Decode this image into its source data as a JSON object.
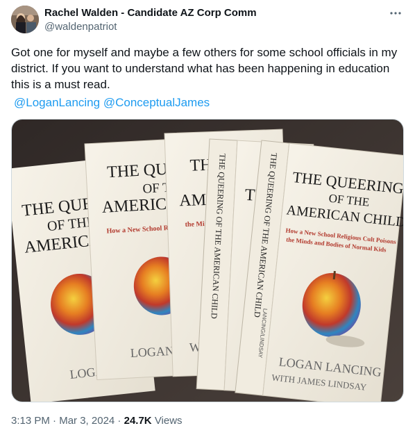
{
  "author": {
    "display_name": "Rachel Walden - Candidate AZ Corp Comm",
    "handle": "@waldenpatriot"
  },
  "more_icon": "more-horizontal-icon",
  "text": "Got one for myself and maybe a few others for some school officials in my district. If you want to understand what has been happening in education this is a must read.",
  "mentions": [
    "@LoganLancing",
    "@ConceptualJames"
  ],
  "book": {
    "title_line1": "THE QUEERING",
    "title_line2": "OF THE",
    "title_line3": "AMERICAN CHILD",
    "subtitle_line1": "How a New School Religious Cult Poisons",
    "subtitle_line2": "the Minds and Bodies of Normal Kids",
    "author_line1": "LOGAN LANCING",
    "author_line2": "WITH JAMES LINDSAY",
    "spine_title": "THE QUEERING OF THE AMERICAN CHILD",
    "spine_author": "LANCING/LINDSAY"
  },
  "meta": {
    "time": "3:13 PM",
    "separator": " · ",
    "date": "Mar 3, 2024",
    "views_count": "24.7K",
    "views_label": "Views"
  },
  "colors": {
    "text": "#0f1419",
    "secondary": "#536471",
    "link": "#1d9bf0",
    "table": "#3b3431",
    "cover": "#f3eee2",
    "subtitle_red": "#b23a2e"
  }
}
